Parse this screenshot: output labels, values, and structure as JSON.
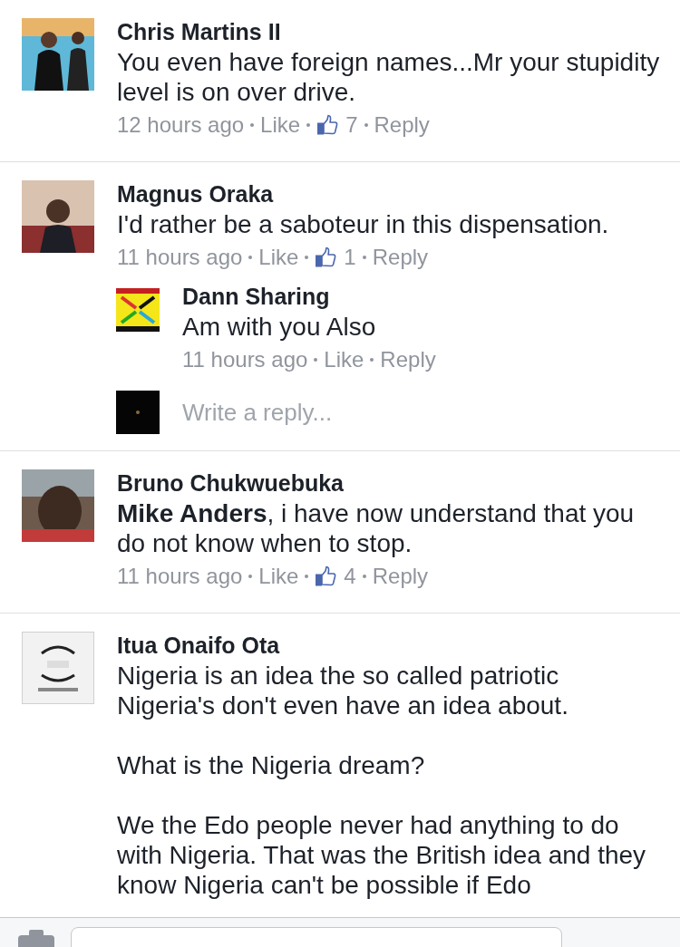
{
  "comments": [
    {
      "name": "Chris Martins II",
      "paragraphs": [
        "You even have foreign names...Mr your stupidity level is on over drive."
      ],
      "time": "12 hours ago",
      "like": "Like",
      "likes": "7",
      "reply": "Reply",
      "avatar": {
        "kind": "picture"
      }
    },
    {
      "name": "Magnus Oraka",
      "paragraphs": [
        "I'd rather be a saboteur in this dispensation."
      ],
      "time": "11 hours ago",
      "like": "Like",
      "likes": "1",
      "reply": "Reply",
      "avatar": {
        "kind": "picture"
      },
      "replies": [
        {
          "name": "Dann Sharing",
          "paragraphs": [
            "Am with you Also"
          ],
          "time": "11 hours ago",
          "like": "Like",
          "reply": "Reply"
        }
      ],
      "reply_field": {
        "placeholder": "Write a reply..."
      }
    },
    {
      "name": "Bruno Chukwuebuka",
      "paragraphs": [
        "**Mike Anders**, i have now understand that you do not know when to stop."
      ],
      "time": "11 hours ago",
      "like": "Like",
      "likes": "4",
      "reply": "Reply",
      "avatar": {
        "kind": "picture"
      }
    },
    {
      "name": "Itua Onaifo Ota",
      "paragraphs": [
        "Nigeria is an idea the so called patriotic Nigeria's don't even have an idea about.",
        "What is the Nigeria dream?",
        "We the Edo people never had anything to do with Nigeria. That was the British idea and they know Nigeria can't be possible if Edo"
      ],
      "avatar": {
        "kind": "picture"
      }
    }
  ]
}
